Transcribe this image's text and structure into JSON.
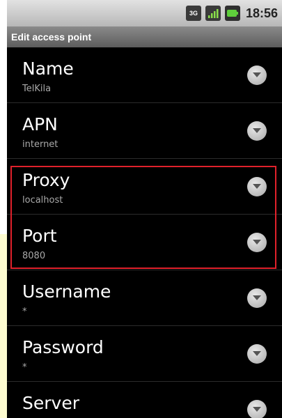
{
  "status_bar": {
    "network_label": "3G",
    "time": "18:56"
  },
  "title": "Edit access point",
  "rows": [
    {
      "label": "Name",
      "value": "TelKila"
    },
    {
      "label": "APN",
      "value": "internet"
    },
    {
      "label": "Proxy",
      "value": "localhost"
    },
    {
      "label": "Port",
      "value": "8080"
    },
    {
      "label": "Username",
      "value": "*"
    },
    {
      "label": "Password",
      "value": "*"
    },
    {
      "label": "Server",
      "value": ""
    }
  ],
  "colors": {
    "highlight": "#e0212b",
    "background": "#000000",
    "label": "#ffffff",
    "value": "#a9a9a9"
  }
}
